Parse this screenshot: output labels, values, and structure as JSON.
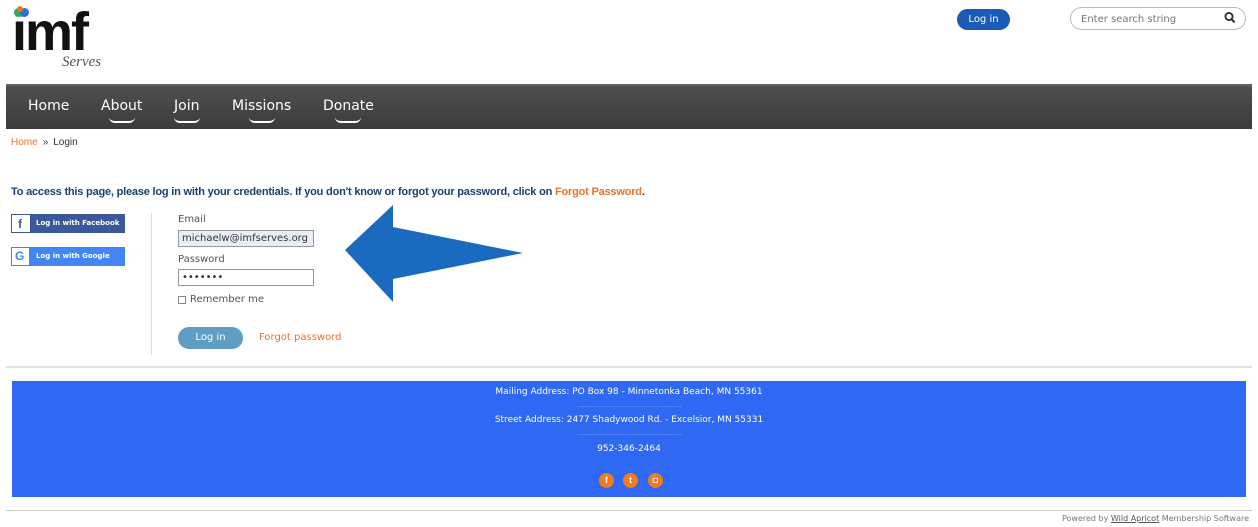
{
  "header": {
    "logo_text": "imf",
    "logo_sub": "Serves",
    "login_label": "Log in",
    "search_placeholder": "Enter search string"
  },
  "nav": {
    "items": [
      {
        "label": "Home"
      },
      {
        "label": "About"
      },
      {
        "label": "Join"
      },
      {
        "label": "Missions"
      },
      {
        "label": "Donate"
      }
    ]
  },
  "breadcrumb": {
    "home": "Home",
    "separator": "»",
    "current": "Login"
  },
  "instruction": {
    "text": "To access this page, please log in with your credentials. If you don't know or forgot your password, click on ",
    "link": "Forgot Password",
    "end": "."
  },
  "social_login": {
    "facebook_label": "Log in with Facebook",
    "google_label": "Log in with Google"
  },
  "form": {
    "email_label": "Email",
    "email_value": "michaelw@imfserves.org",
    "password_label": "Password",
    "password_value": "•••••••",
    "remember_label": "Remember me",
    "login_button": "Log in",
    "forgot_label": "Forgot password"
  },
  "footer": {
    "mailing": "Mailing Address: PO Box 98 - Minnetonka Beach, MN 55361",
    "divider1": "----------------------------------------",
    "street": "Street Address: 2477 Shadywood Rd. - Excelsior, MN 55331",
    "divider2": "----------------------------------------",
    "phone": "952-346-2464"
  },
  "powered": {
    "prefix": "Powered by ",
    "brand": "Wild Apricot",
    "suffix": " Membership Software"
  },
  "colors": {
    "accent_orange": "#e8732b",
    "nav_bg": "#3c3c3c",
    "footer_bg": "#2f68f2",
    "arrow": "#1a6bbf"
  }
}
